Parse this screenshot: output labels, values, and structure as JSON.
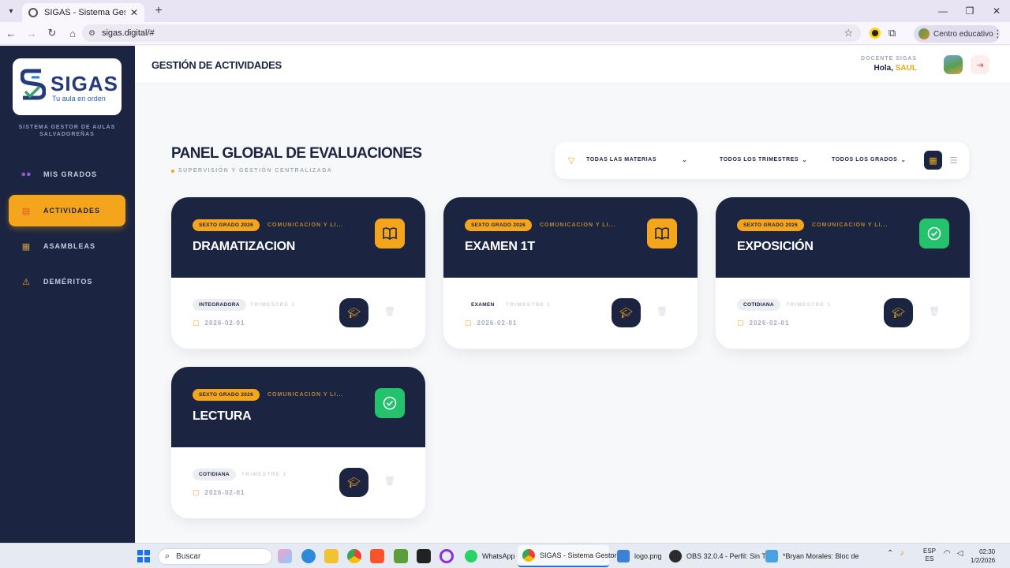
{
  "browser": {
    "tab_title": "SIGAS - Sistema Gestor de Aula",
    "url": "sigas.digital/#",
    "profile": "Centro educativo"
  },
  "sidebar": {
    "logo_name": "SIGAS",
    "logo_slogan": "Tu aula en orden",
    "system_name_line1": "SISTEMA GESTOR DE AULAS",
    "system_name_line2": "SALVADOREÑAS",
    "items": [
      {
        "label": "MIS GRADOS",
        "icon": "users-icon"
      },
      {
        "label": "ACTIVIDADES",
        "icon": "notebook-icon"
      },
      {
        "label": "ASAMBLEAS",
        "icon": "assembly-icon"
      },
      {
        "label": "DEMÉRITOS",
        "icon": "warning-icon"
      }
    ]
  },
  "header": {
    "title": "GESTIÓN DE ACTIVIDADES",
    "role": "DOCENTE SIGAS",
    "greeting": "Hola,",
    "user": "SAUL"
  },
  "panel": {
    "title": "PANEL GLOBAL DE EVALUACIONES",
    "subtitle": "SUPERVISIÓN Y GESTIÓN CENTRALIZADA"
  },
  "filters": {
    "subject": "TODAS LAS MATERIAS",
    "trimester": "TODOS LOS TRIMESTRES",
    "grade": "TODOS LOS GRADOS"
  },
  "cards": [
    {
      "grade": "SEXTO GRADO 2026",
      "subject": "COMUNICACIÓN Y LI...",
      "title": "DRAMATIZACION",
      "type": "INTEGRADORA",
      "trimester": "TRIMESTRE 1",
      "date": "2026-02-01",
      "status": "book"
    },
    {
      "grade": "SEXTO GRADO 2026",
      "subject": "COMUNICACIÓN Y LI...",
      "title": "EXAMEN 1T",
      "type": "EXAMEN",
      "trimester": "TRIMESTRE 1",
      "date": "2026-02-01",
      "status": "book"
    },
    {
      "grade": "SEXTO GRADO 2026",
      "subject": "COMUNICACIÓN Y LI...",
      "title": "EXPOSICIÓN",
      "type": "COTIDIANA",
      "trimester": "TRIMESTRE 1",
      "date": "2026-02-01",
      "status": "check"
    },
    {
      "grade": "SEXTO GRADO 2026",
      "subject": "COMUNICACIÓN Y LI...",
      "title": "LECTURA",
      "type": "COTIDIANA",
      "trimester": "TRIMESTRE 1",
      "date": "2026-02-01",
      "status": "check"
    }
  ],
  "taskbar": {
    "search": "Buscar",
    "items": [
      "WhatsApp",
      "SIGAS - Sistema Gestor",
      "logo.png",
      "OBS 32.0.4 - Perfil: Sin T",
      "*Bryan Morales: Bloc de"
    ],
    "lang1": "ESP",
    "lang2": "ES",
    "time": "02:30",
    "date": "1/2/2026"
  },
  "colors": {
    "navy": "#1b2440",
    "accent": "#f4a51c",
    "success": "#25c26e"
  }
}
